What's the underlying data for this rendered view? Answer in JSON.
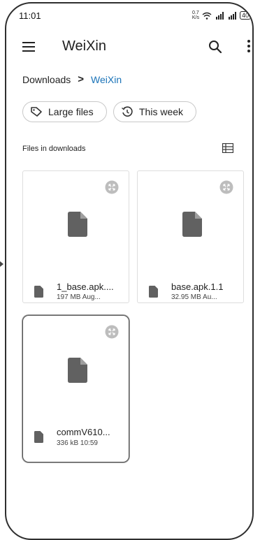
{
  "status_bar": {
    "time": "11:01",
    "network_speed_value": "0.7",
    "network_speed_unit": "K/s",
    "battery": "40"
  },
  "app_bar": {
    "title": "WeiXin",
    "menu_icon": "hamburger-menu-icon",
    "search_icon": "search-icon",
    "more_icon": "more-vertical-icon"
  },
  "breadcrumb": {
    "parent": "Downloads",
    "separator": ">",
    "current": "WeiXin",
    "current_color": "#1a73b8"
  },
  "filters": [
    {
      "label": "Large files",
      "icon": "tag-icon"
    },
    {
      "label": "This week",
      "icon": "history-icon"
    }
  ],
  "section": {
    "label": "Files in downloads",
    "view_icon": "list-view-icon"
  },
  "files": [
    {
      "name": "1_base.apk....",
      "meta": "197 MB Aug..."
    },
    {
      "name": "base.apk.1.1",
      "meta": "32.95 MB Au..."
    },
    {
      "name": "commV610...",
      "meta": "336 kB 10:59"
    }
  ]
}
